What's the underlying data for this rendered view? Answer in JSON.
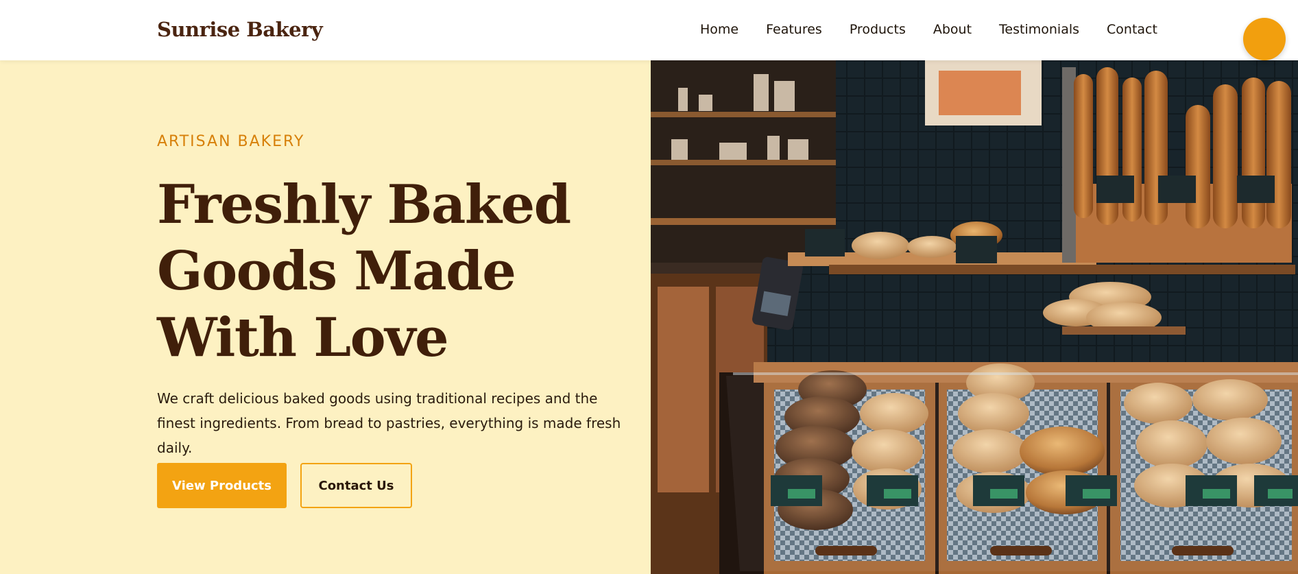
{
  "header": {
    "brand": "Sunrise Bakery",
    "nav": [
      "Home",
      "Features",
      "Products",
      "About",
      "Testimonials",
      "Contact"
    ],
    "accent": "#f29f0e"
  },
  "hero": {
    "eyebrow": "ARTISAN BAKERY",
    "title": "Freshly Baked Goods Made With Love",
    "description": "We craft delicious baked goods using traditional recipes and the finest ingredients. From bread to pastries, everything is made fresh daily.",
    "primary_button": "View Products",
    "secondary_button": "Contact Us",
    "background": "#fdf1c2",
    "title_color": "#401f0a",
    "eyebrow_color": "#d7800a"
  }
}
